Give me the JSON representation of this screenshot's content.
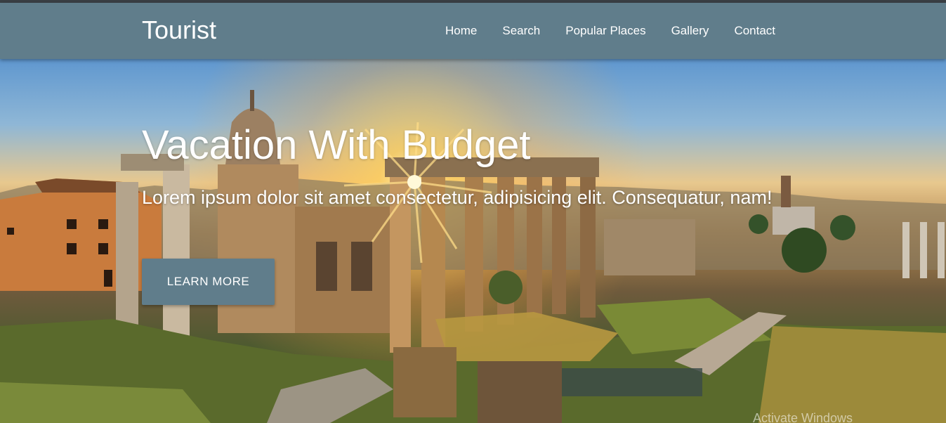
{
  "navbar": {
    "brand": "Tourist",
    "links": [
      "Home",
      "Search",
      "Popular Places",
      "Gallery",
      "Contact"
    ]
  },
  "hero": {
    "title": "Vacation With Budget",
    "subtitle": "Lorem ipsum dolor sit amet consectetur, adipisicing elit. Consequatur, nam!",
    "button_label": "LEARN MORE"
  },
  "os_watermark": "Activate Windows",
  "colors": {
    "navbar": "#607d8b",
    "button": "#607d8b",
    "text": "#ffffff"
  }
}
